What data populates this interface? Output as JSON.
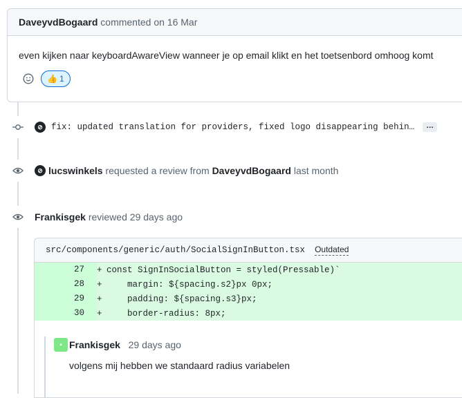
{
  "comment": {
    "author": "DaveyvdBogaard",
    "action": "commented on 16 Mar",
    "body": "even kijken naar keyboardAwareView wanneer je op email klikt en het toetsenbord omhoog komt",
    "reaction_emoji": "👍",
    "reaction_count": "1"
  },
  "commit": {
    "message": "fix: updated translation for providers, fixed logo disappearing behin…",
    "more_label": "…"
  },
  "review_request": {
    "actor": "lucswinkels",
    "action": "requested a review from",
    "target": "DaveyvdBogaard",
    "time": "last month"
  },
  "review": {
    "author": "Frankisgek",
    "action": "reviewed 29 days ago",
    "file_path": "src/components/generic/auth/SocialSignInButton.tsx",
    "outdated_label": "Outdated",
    "lines": [
      {
        "num": "27",
        "sign": "+",
        "code": "const SignInSocialButton = styled(Pressable)`"
      },
      {
        "num": "28",
        "sign": "+",
        "code": "    margin: ${spacing.s2}px 0px;"
      },
      {
        "num": "29",
        "sign": "+",
        "code": "    padding: ${spacing.s3}px;"
      },
      {
        "num": "30",
        "sign": "+",
        "code": "    border-radius: 8px;"
      }
    ],
    "comment_author": "Frankisgek",
    "comment_time": "29 days ago",
    "comment_body": "volgens mij hebben we standaard radius variabelen"
  }
}
